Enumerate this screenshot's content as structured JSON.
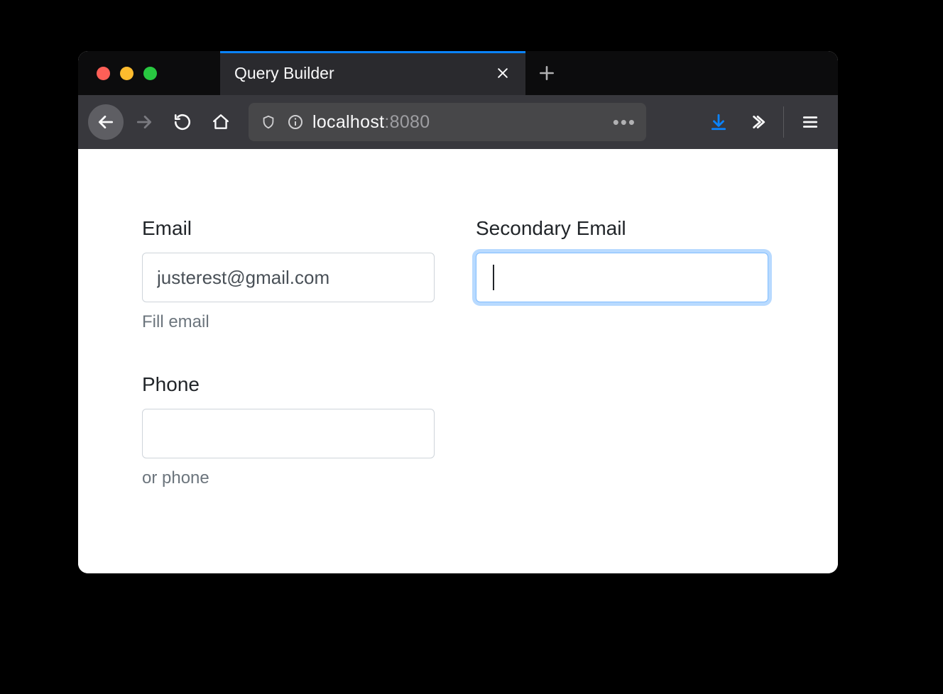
{
  "window": {
    "tab_title": "Query Builder"
  },
  "urlbar": {
    "host": "localhost",
    "port": ":8080"
  },
  "form": {
    "email": {
      "label": "Email",
      "value": "justerest@gmail.com",
      "help": "Fill email"
    },
    "secondary_email": {
      "label": "Secondary Email",
      "value": ""
    },
    "phone": {
      "label": "Phone",
      "value": "",
      "help": "or phone"
    }
  }
}
